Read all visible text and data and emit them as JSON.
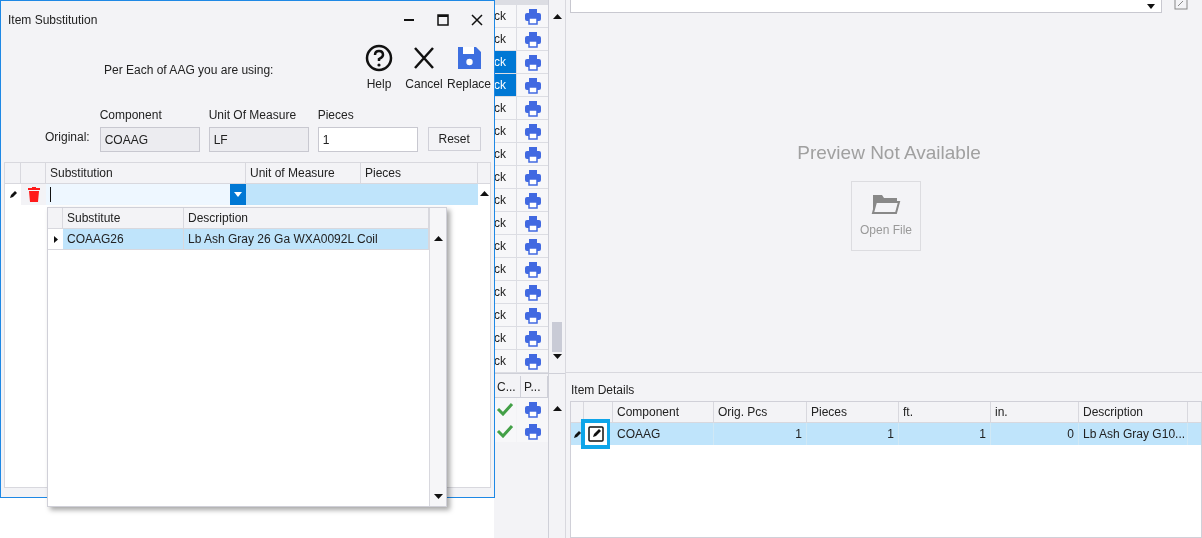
{
  "background_grid": {
    "rows": [
      {
        "text": "ck",
        "selected": false
      },
      {
        "text": "ck",
        "selected": false
      },
      {
        "text": "ck",
        "selected": true
      },
      {
        "text": "ck",
        "selected": true
      },
      {
        "text": "ck",
        "selected": false
      },
      {
        "text": "ck",
        "selected": false
      },
      {
        "text": "ck",
        "selected": false
      },
      {
        "text": "ck",
        "selected": false
      },
      {
        "text": "ck",
        "selected": false
      },
      {
        "text": "ck",
        "selected": false
      },
      {
        "text": "ck",
        "selected": false
      },
      {
        "text": "ck",
        "selected": false
      },
      {
        "text": "ck",
        "selected": false
      },
      {
        "text": "ck",
        "selected": false
      },
      {
        "text": "ck",
        "selected": false
      },
      {
        "text": "ck",
        "selected": false
      }
    ]
  },
  "lower_grid": {
    "columns": [
      "C...",
      "P..."
    ]
  },
  "preview": {
    "message": "Preview Not Available",
    "button": "Open File"
  },
  "item_details": {
    "title": "Item Details",
    "columns": [
      "Component",
      "Orig. Pcs",
      "Pieces",
      "ft.",
      "in.",
      "Description"
    ],
    "rows": [
      {
        "selected": true,
        "cells": [
          "COAAG",
          "1",
          "1",
          "1",
          "0",
          "Lb Ash Gray G10..."
        ]
      }
    ]
  },
  "dialog": {
    "title": "Item Substitution",
    "prompt": "Per Each of AAG you are using:",
    "toolbar": [
      {
        "kind": "help",
        "label": "Help"
      },
      {
        "kind": "cancel",
        "label": "Cancel"
      },
      {
        "kind": "save",
        "label": "Replace"
      }
    ],
    "original_label": "Original:",
    "fields": [
      {
        "label": "Component",
        "value": "COAAG",
        "readonly": true
      },
      {
        "label": "Unit Of Measure",
        "value": "LF",
        "readonly": true
      },
      {
        "label": "Pieces",
        "value": "1",
        "readonly": false
      }
    ],
    "reset": "Reset",
    "grid": {
      "columns": [
        "Substitution",
        "Unit of Measure",
        "Pieces"
      ]
    },
    "dropdown": {
      "columns": [
        "Substitute",
        "Description"
      ],
      "rows": [
        {
          "selected": true,
          "cells": [
            "COAAG26",
            "Lb Ash Gray 26 Ga WXA0092L Coil"
          ]
        }
      ]
    }
  }
}
